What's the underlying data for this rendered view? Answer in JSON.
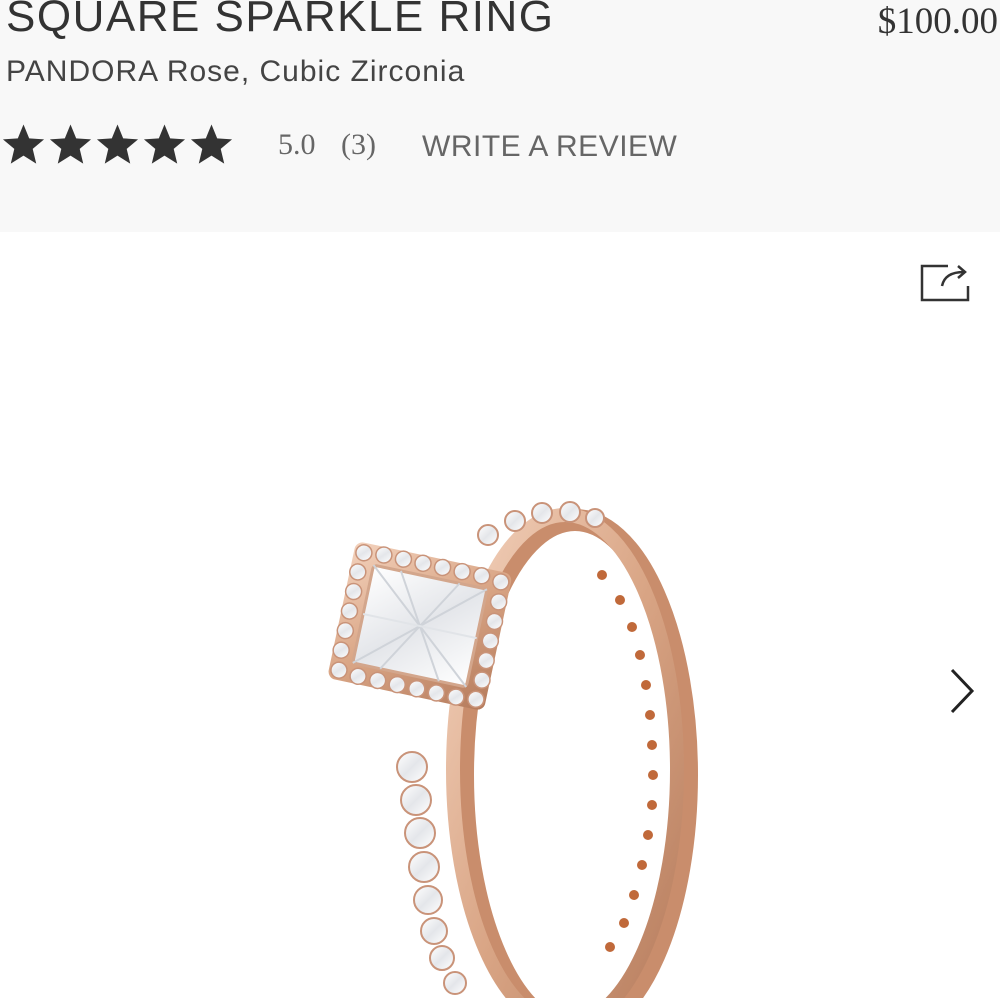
{
  "product": {
    "title": "SQUARE SPARKLE RING",
    "price": "$100.00",
    "subtitle": "PANDORA Rose, Cubic Zirconia"
  },
  "rating": {
    "stars": 5,
    "max_stars": 5,
    "value": "5.0",
    "count": "(3)",
    "write_review_label": "WRITE A REVIEW"
  },
  "icons": {
    "star": "star-icon",
    "share": "share-icon",
    "next": "chevron-right-icon"
  },
  "colors": {
    "header_bg": "#f8f8f8",
    "text_dark": "#333333",
    "text_muted": "#666666",
    "rose_gold": "#d9a585"
  }
}
